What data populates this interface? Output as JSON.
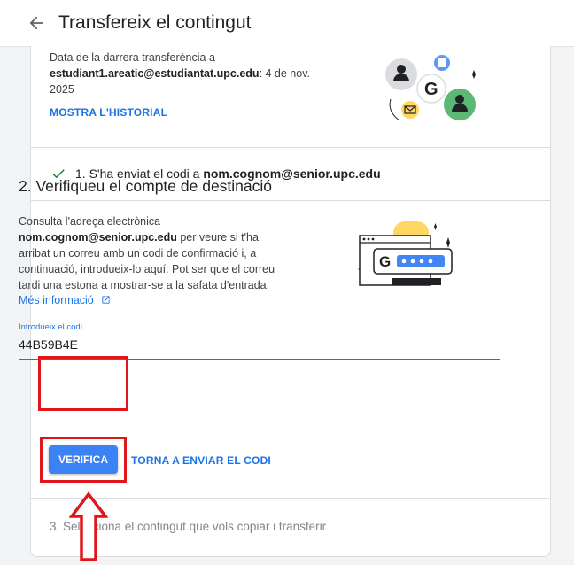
{
  "header": {
    "title": "Transfereix el contingut",
    "back_icon": "arrow-back-icon"
  },
  "last_transfer": {
    "prefix": "Data de la darrera transferència a ",
    "email": "estudiant1.areatic@estudiantat.upc.edu",
    "suffix": ": 4 de nov. 2025",
    "history_link": "MOSTRA L'HISTORIAL"
  },
  "step1": {
    "text": "1. S'ha enviat el codi a ",
    "email": "nom.cognom@senior.upc.edu",
    "icon": "check-icon"
  },
  "step2": {
    "title": "2. Verifiqueu el compte de destinació",
    "consult_prefix": "Consulta l'adreça electrònica",
    "email": "nom.cognom@senior.upc.edu",
    "consult_suffix": " per veure si t'ha arribat un correu amb un codi de confirmació i, a continuació, introdueix-lo aquí. Pot ser que el correu tardi una estona a mostrar-se a la safata d'entrada.",
    "more_info": "Més informació",
    "field_label": "Introdueix el codi",
    "field_value": "44B59B4E",
    "verify_button": "VERIFICA",
    "resend_link": "TORNA A ENVIAR EL CODI"
  },
  "step3": {
    "text": "3. Selecciona el contingut que vols copiar i transferir"
  },
  "colors": {
    "accent": "#1a73e8",
    "highlight": "#e0161b",
    "check": "#188038"
  }
}
